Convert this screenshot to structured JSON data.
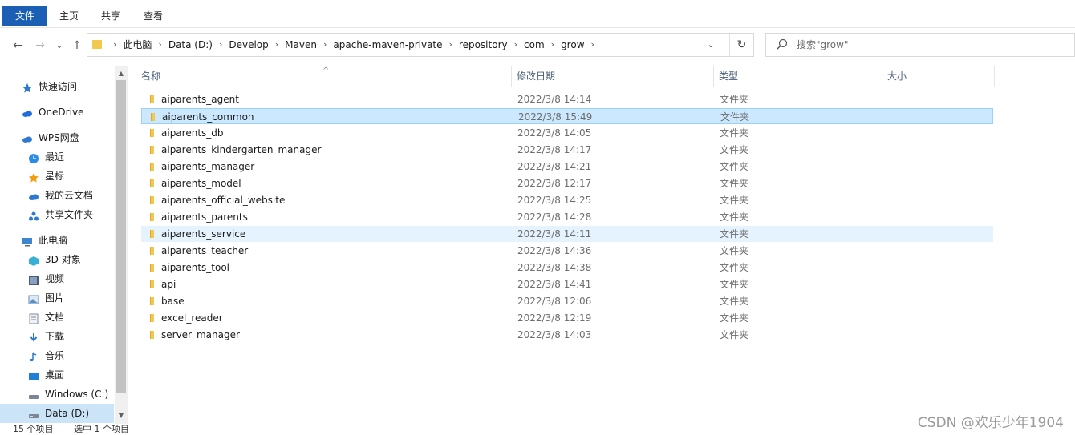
{
  "ribbon": {
    "file_tab": "文件",
    "tabs": [
      "主页",
      "共享",
      "查看"
    ]
  },
  "nav": {
    "back": "←",
    "forward": "→",
    "recent_dropdown": "⌄",
    "up": "↑"
  },
  "address": {
    "crumbs": [
      "此电脑",
      "Data (D:)",
      "Develop",
      "Maven",
      "apache-maven-private",
      "repository",
      "com",
      "grow"
    ],
    "dropdown": "⌄",
    "refresh": "↻"
  },
  "search": {
    "placeholder": "搜索\"grow\""
  },
  "sidebar": {
    "items": [
      {
        "label": "快速访问",
        "icon": "star-pin-icon",
        "color": "#2b79d0"
      },
      {
        "label": "OneDrive",
        "icon": "cloud-icon",
        "color": "#1e6fd9"
      },
      {
        "label": "WPS网盘",
        "icon": "wps-cloud-icon",
        "color": "#2b79d0"
      },
      {
        "label": "最近",
        "icon": "clock-icon",
        "color": "#2b8be8"
      },
      {
        "label": "星标",
        "icon": "star-icon",
        "color": "#f39c12"
      },
      {
        "label": "我的云文档",
        "icon": "cloud-doc-icon",
        "color": "#2b79d0"
      },
      {
        "label": "共享文件夹",
        "icon": "shared-folder-icon",
        "color": "#2b79d0"
      },
      {
        "label": "此电脑",
        "icon": "computer-icon",
        "color": "#3c86d0"
      },
      {
        "label": "3D 对象",
        "icon": "3d-objects-icon",
        "color": "#3ab0d6"
      },
      {
        "label": "视频",
        "icon": "video-icon",
        "color": "#4a5a78"
      },
      {
        "label": "图片",
        "icon": "pictures-icon",
        "color": "#5a8fc0"
      },
      {
        "label": "文档",
        "icon": "documents-icon",
        "color": "#808a96"
      },
      {
        "label": "下载",
        "icon": "download-icon",
        "color": "#2b79d0"
      },
      {
        "label": "音乐",
        "icon": "music-icon",
        "color": "#2b79d0"
      },
      {
        "label": "桌面",
        "icon": "desktop-icon",
        "color": "#1e7fd6"
      },
      {
        "label": "Windows (C:)",
        "icon": "drive-c-icon",
        "color": "#7b8794"
      },
      {
        "label": "Data (D:)",
        "icon": "drive-d-icon",
        "color": "#7b8794"
      }
    ],
    "scroll_up": "▲",
    "scroll_down": "▼"
  },
  "columns": {
    "name": "名称",
    "date": "修改日期",
    "type": "类型",
    "size": "大小"
  },
  "files": [
    {
      "name": "aiparents_agent",
      "date": "2022/3/8 14:14",
      "type": "文件夹"
    },
    {
      "name": "aiparents_common",
      "date": "2022/3/8 15:49",
      "type": "文件夹"
    },
    {
      "name": "aiparents_db",
      "date": "2022/3/8 14:05",
      "type": "文件夹"
    },
    {
      "name": "aiparents_kindergarten_manager",
      "date": "2022/3/8 14:17",
      "type": "文件夹"
    },
    {
      "name": "aiparents_manager",
      "date": "2022/3/8 14:21",
      "type": "文件夹"
    },
    {
      "name": "aiparents_model",
      "date": "2022/3/8 12:17",
      "type": "文件夹"
    },
    {
      "name": "aiparents_official_website",
      "date": "2022/3/8 14:25",
      "type": "文件夹"
    },
    {
      "name": "aiparents_parents",
      "date": "2022/3/8 14:28",
      "type": "文件夹"
    },
    {
      "name": "aiparents_service",
      "date": "2022/3/8 14:11",
      "type": "文件夹"
    },
    {
      "name": "aiparents_teacher",
      "date": "2022/3/8 14:36",
      "type": "文件夹"
    },
    {
      "name": "aiparents_tool",
      "date": "2022/3/8 14:38",
      "type": "文件夹"
    },
    {
      "name": "api",
      "date": "2022/3/8 14:41",
      "type": "文件夹"
    },
    {
      "name": "base",
      "date": "2022/3/8 12:06",
      "type": "文件夹"
    },
    {
      "name": "excel_reader",
      "date": "2022/3/8 12:19",
      "type": "文件夹"
    },
    {
      "name": "server_manager",
      "date": "2022/3/8 14:03",
      "type": "文件夹"
    }
  ],
  "selected_row": "aiparents_common",
  "hover_row": "aiparents_service",
  "status": {
    "count": "15 个项目",
    "selected": "选中 1 个项目"
  },
  "watermark": "CSDN @欢乐少年1904",
  "colors": {
    "accent": "#1a5fb4",
    "selected_bg": "#cce8ff",
    "hover_bg": "#e5f3ff",
    "folder": "#f2c94c"
  }
}
